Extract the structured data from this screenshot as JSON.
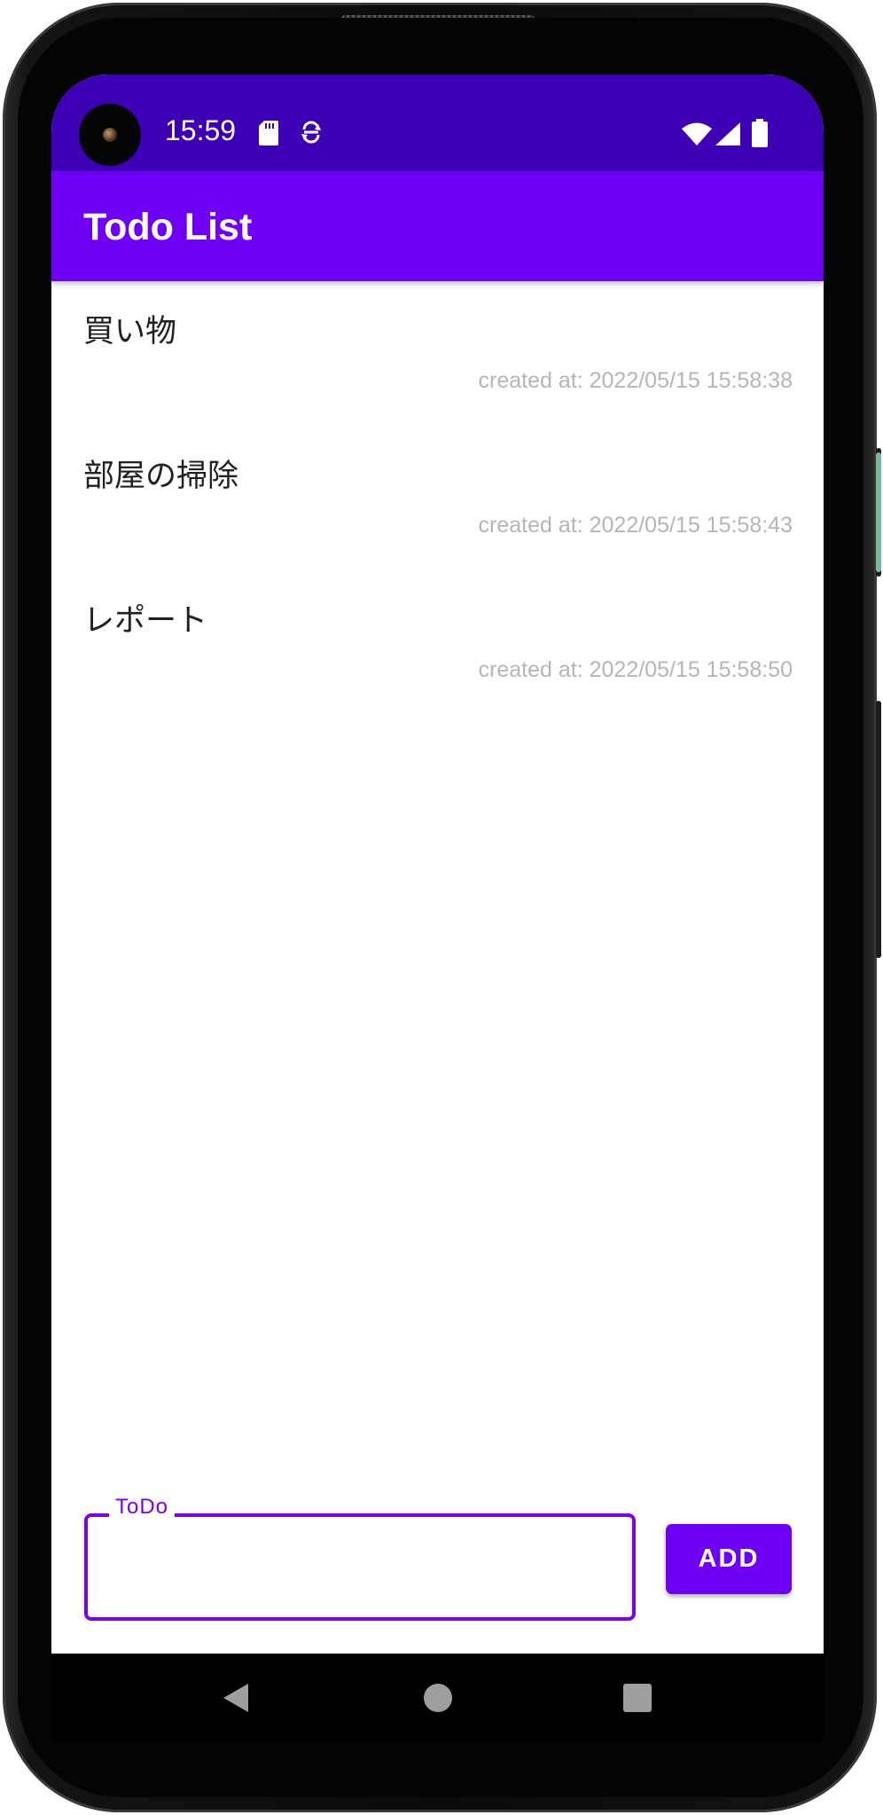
{
  "status_bar": {
    "time": "15:59",
    "icons": [
      "sd-card-icon",
      "sync-icon",
      "wifi-icon",
      "cellular-signal-icon",
      "battery-icon"
    ],
    "background_color": "#3d00b5"
  },
  "app_bar": {
    "title": "Todo List",
    "background_color": "#6f00f5"
  },
  "todos": [
    {
      "title": "買い物",
      "created": "created at: 2022/05/15 15:58:38"
    },
    {
      "title": "部屋の掃除",
      "created": "created at: 2022/05/15 15:58:43"
    },
    {
      "title": "レポート",
      "created": "created at: 2022/05/15 15:58:50"
    }
  ],
  "input": {
    "label": "ToDo",
    "value": ""
  },
  "add_button": {
    "label": "ADD"
  },
  "nav_bar": {
    "icons": [
      "back-icon",
      "home-icon",
      "recents-icon"
    ]
  }
}
